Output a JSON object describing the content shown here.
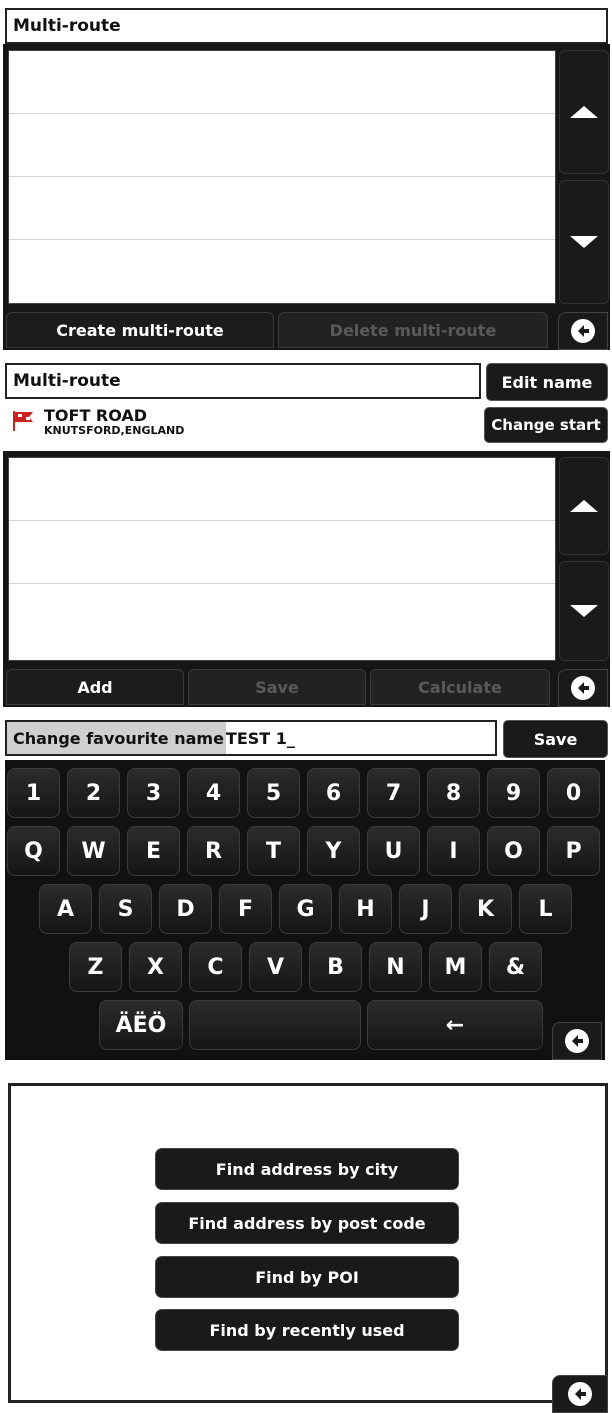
{
  "screen1": {
    "title": "Multi-route",
    "buttons": {
      "create": "Create multi-route",
      "delete": "Delete multi-route"
    }
  },
  "screen2": {
    "title": "Multi-route",
    "edit_name": "Edit name",
    "change_start": "Change start",
    "start_location": {
      "street": "TOFT ROAD",
      "city": "KNUTSFORD,ENGLAND"
    },
    "buttons": {
      "add": "Add",
      "save": "Save",
      "calculate": "Calculate"
    }
  },
  "screen3": {
    "field_label": "Change favourite name",
    "field_value": "TEST 1_",
    "save": "Save",
    "keys": {
      "row1": [
        "1",
        "2",
        "3",
        "4",
        "5",
        "6",
        "7",
        "8",
        "9",
        "0"
      ],
      "row2": [
        "Q",
        "W",
        "E",
        "R",
        "T",
        "Y",
        "U",
        "I",
        "O",
        "P"
      ],
      "row3": [
        "A",
        "S",
        "D",
        "F",
        "G",
        "H",
        "J",
        "K",
        "L"
      ],
      "row4": [
        "Z",
        "X",
        "C",
        "V",
        "B",
        "N",
        "M",
        "&"
      ],
      "special": "ÄËÖ",
      "backspace": "←"
    }
  },
  "screen4": {
    "menu": [
      "Find address by city",
      "Find address by post code",
      "Find by POI",
      "Find by recently used"
    ]
  },
  "colors": {
    "panel": "#1a1a1a",
    "text_light": "#ffffff",
    "disabled": "#5a5a5a",
    "flag": "#cc2222"
  }
}
